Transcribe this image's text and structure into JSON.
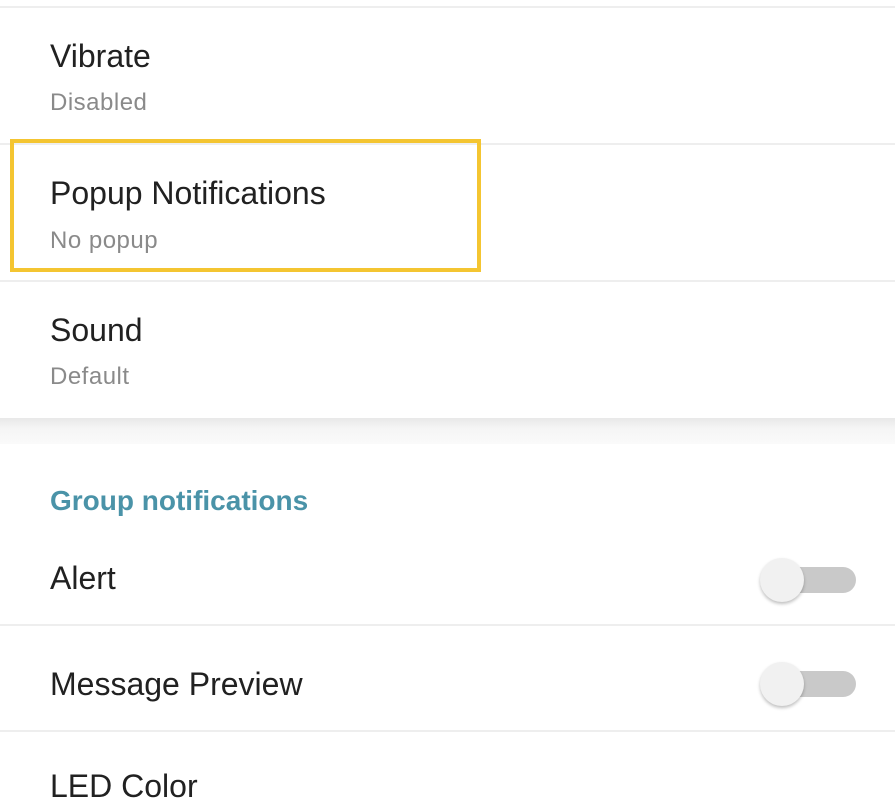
{
  "settings": {
    "vibrate": {
      "title": "Vibrate",
      "value": "Disabled"
    },
    "popup": {
      "title": "Popup Notifications",
      "value": "No popup"
    },
    "sound": {
      "title": "Sound",
      "value": "Default"
    }
  },
  "group_notifications": {
    "header": "Group notifications",
    "alert": {
      "title": "Alert",
      "enabled": false
    },
    "message_preview": {
      "title": "Message Preview",
      "enabled": false
    },
    "led_color": {
      "title": "LED Color"
    }
  },
  "colors": {
    "highlight": "#f4c531",
    "section_header": "#4a93a8",
    "toggle_off_track": "#c9c9c9",
    "toggle_off_thumb": "#f1f1f1"
  }
}
